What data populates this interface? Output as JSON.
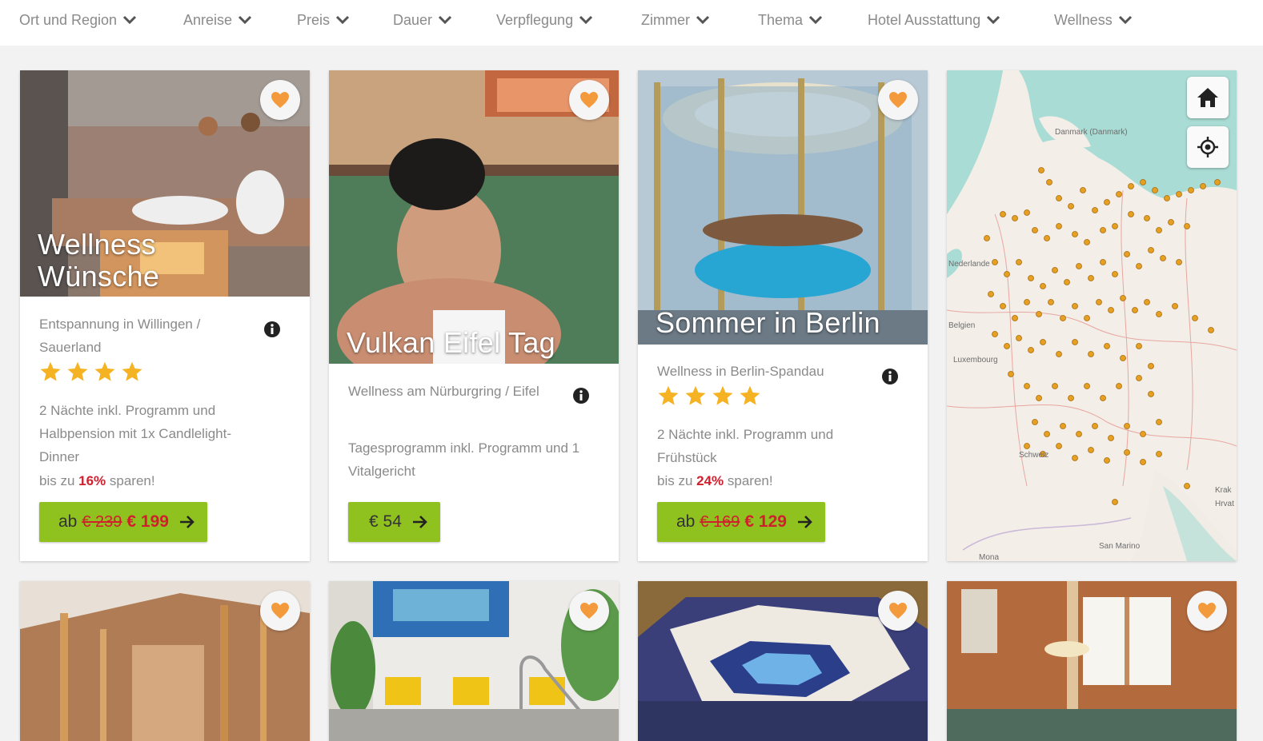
{
  "filters": [
    "Ort und Region",
    "Anreise",
    "Preis",
    "Dauer",
    "Verpflegung",
    "Zimmer",
    "Thema",
    "Hotel Ausstattung",
    "Wellness"
  ],
  "cards": [
    {
      "overlay_line1": "Wellness",
      "overlay_line2": "Wünsche",
      "location": "Entspannung in Willingen / Sauerland",
      "stars": 4,
      "description": "2 Nächte inkl. Programm und Halbpension mit 1x Candlelight-Dinner",
      "save_prefix": "bis zu ",
      "save_pct": "16%",
      "save_suffix": " sparen!",
      "price_prefix": "ab",
      "price_old": "€ 239",
      "price_new": "€ 199"
    },
    {
      "overlay_line1": "Vulkan Eifel Tag",
      "location": "Wellness am Nürburgring / Eifel",
      "description": "Tagesprogramm inkl. Programm und 1 Vitalgericht",
      "price_plain": "€ 54"
    },
    {
      "overlay_line1": "Sommer in Berlin",
      "location": "Wellness in Berlin-Spandau",
      "stars": 4,
      "description": "2 Nächte inkl. Programm und Frühstück",
      "save_prefix": "bis zu ",
      "save_pct": "24%",
      "save_suffix": " sparen!",
      "price_prefix": "ab",
      "price_old": "€ 169",
      "price_new": "€ 129"
    }
  ],
  "map": {
    "labels": [
      "Danmark (Danmark)",
      "Nederlande",
      "Belgien",
      "Luxembourg",
      "Schweiz",
      "San Marino",
      "Krak",
      "Hrvat",
      "Mona"
    ]
  },
  "icons": {
    "heart": "heart-icon",
    "info": "info-icon",
    "star": "star-icon",
    "arrow": "arrow-right-icon",
    "home": "home-icon",
    "locate": "locate-icon",
    "chevron": "chevron-down-icon"
  },
  "colors": {
    "accent_green": "#8fc21f",
    "heart_orange": "#f39a3d",
    "star_yellow": "#f5b324",
    "sale_red": "#d0202e",
    "map_water": "#a9dcd4"
  }
}
